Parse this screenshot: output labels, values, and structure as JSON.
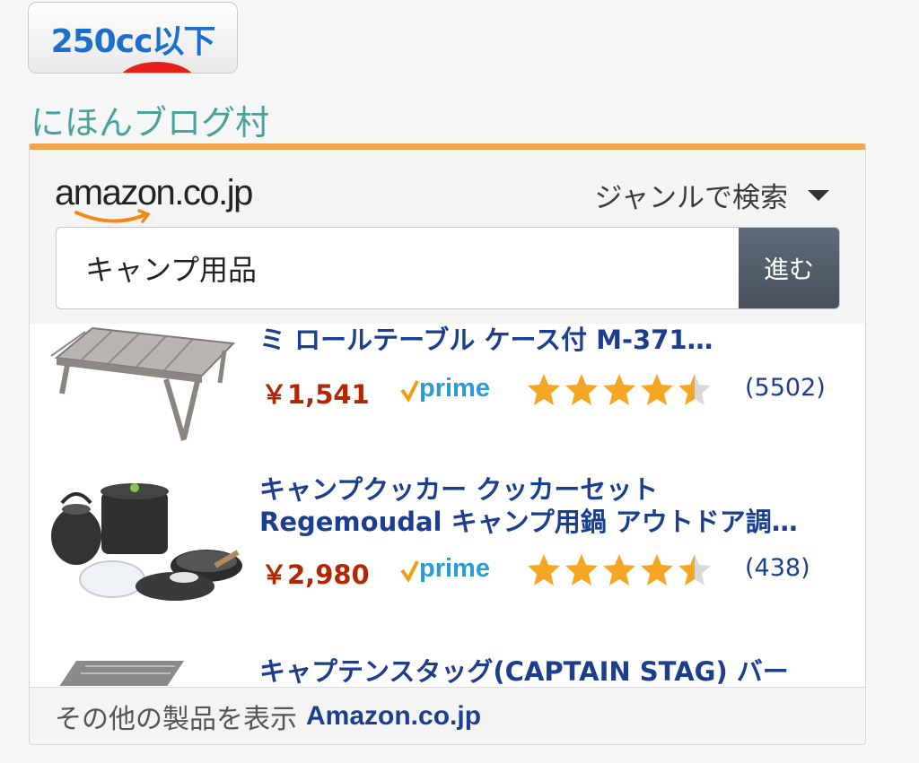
{
  "blog_badge": {
    "text": "250cc以下"
  },
  "blog_link": {
    "text": "にほんブログ村"
  },
  "amazon_widget": {
    "logo_text": "amazon.co.jp",
    "genre_label": "ジャンルで検索",
    "search": {
      "value": "キャンプ用品",
      "button_label": "進む"
    },
    "products": [
      {
        "title": "ミ ロールテーブル ケース付 M-371…",
        "price": "￥1,541",
        "prime": "prime",
        "rating": 4.5,
        "reviews": "(5502)"
      },
      {
        "title_line1": "キャンプクッカー クッカーセット",
        "title_line2": "Regemoudal キャンプ用鍋 アウトドア調…",
        "price": "￥2,980",
        "prime": "prime",
        "rating": 4.5,
        "reviews": "(438)"
      },
      {
        "title": "キャプテンスタッグ(CAPTAIN STAG) バー"
      }
    ],
    "footer": {
      "text": "その他の製品を表示",
      "site": "Amazon.co.jp"
    }
  },
  "colors": {
    "accent_orange": "#f0a64c",
    "price_red": "#b12704",
    "link_blue": "#1b3e8f",
    "blog_green": "#4aa29b",
    "star_gold": "#f5a623"
  },
  "icons": [
    "amazon-smile-icon",
    "caret-down-icon",
    "prime-check-icon",
    "star-icon"
  ]
}
